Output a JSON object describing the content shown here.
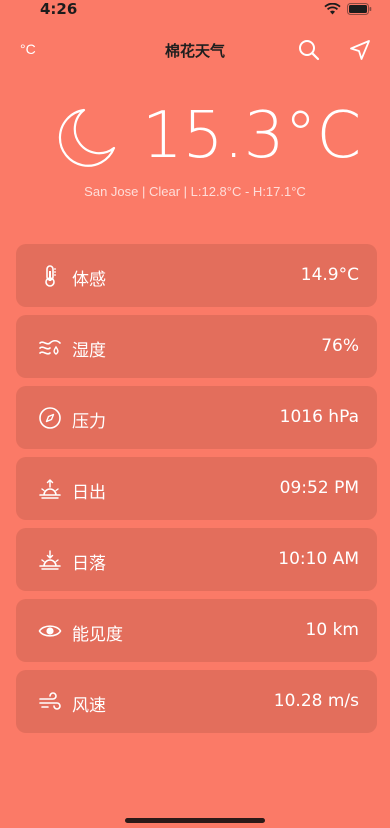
{
  "status_bar": {
    "time": "4:26"
  },
  "nav": {
    "unit_toggle": "°C",
    "title": "棉花天气"
  },
  "current": {
    "temperature": "15.3°C",
    "summary": "San Jose | Clear | L:12.8°C - H:17.1°C",
    "icon": "moon-icon"
  },
  "details": [
    {
      "icon": "thermometer-icon",
      "label": "体感",
      "value": "14.9°C"
    },
    {
      "icon": "humidity-icon",
      "label": "湿度",
      "value": "76%"
    },
    {
      "icon": "compass-icon",
      "label": "压力",
      "value": "1016 hPa"
    },
    {
      "icon": "sunrise-icon",
      "label": "日出",
      "value": "09:52 PM"
    },
    {
      "icon": "sunset-icon",
      "label": "日落",
      "value": "10:10 AM"
    },
    {
      "icon": "eye-icon",
      "label": "能见度",
      "value": "10 km"
    },
    {
      "icon": "wind-icon",
      "label": "风速",
      "value": "10.28 m/s"
    }
  ],
  "colors": {
    "background": "#fb7a67",
    "card": "rgba(120,55,45,0.18)",
    "text": "#ffffff"
  }
}
